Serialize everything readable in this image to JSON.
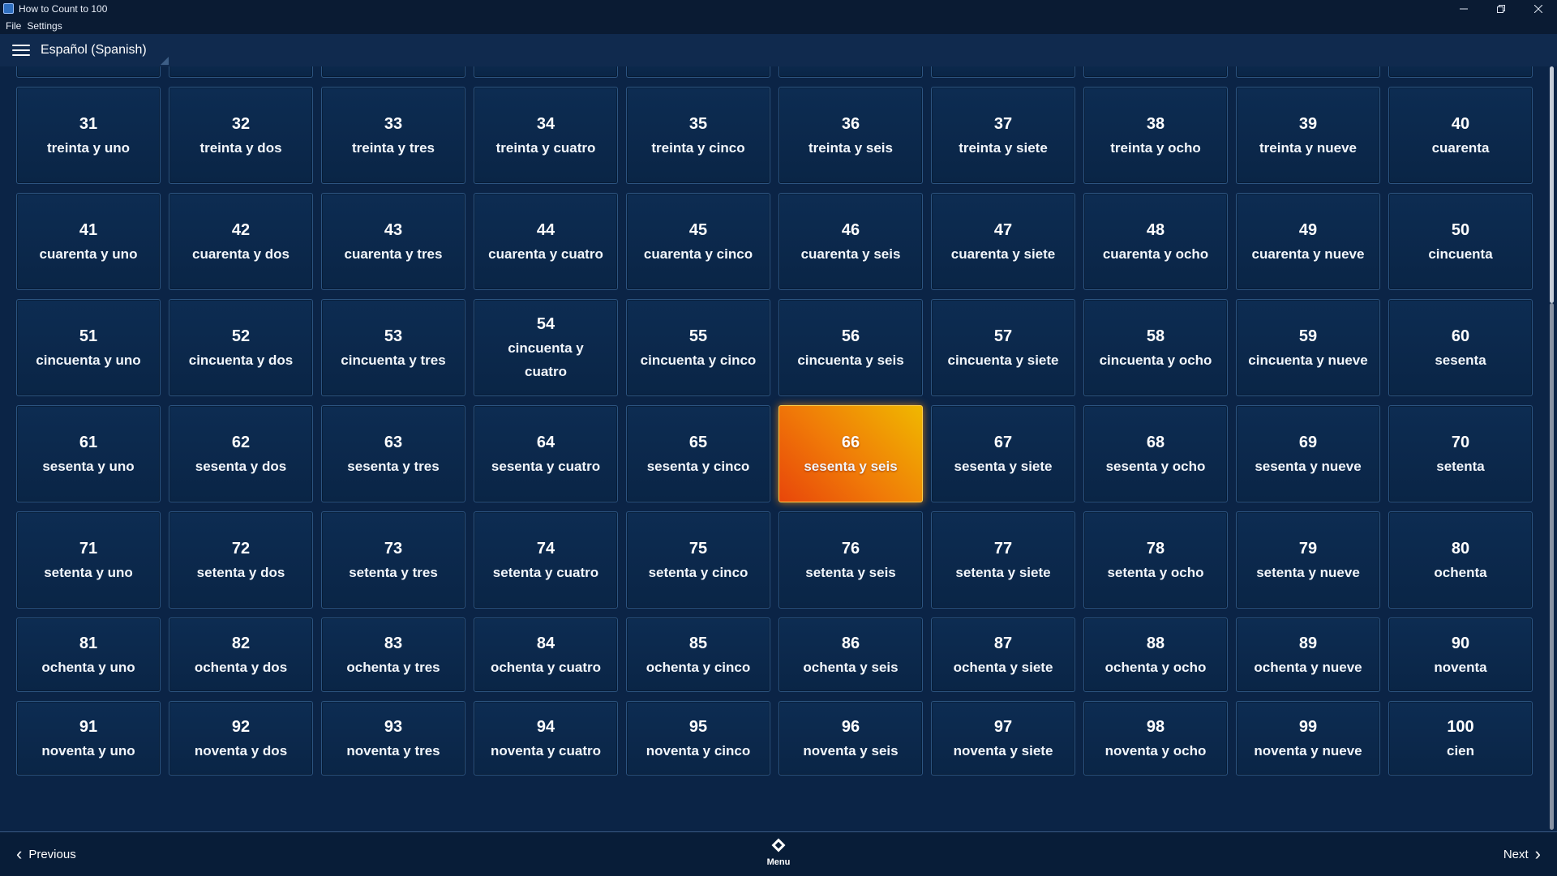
{
  "window": {
    "title": "How to Count to 100"
  },
  "menubar": {
    "items": [
      "File",
      "Settings"
    ]
  },
  "header": {
    "language": "Español (Spanish)"
  },
  "grid": {
    "active_number": 66,
    "tiles": [
      {
        "n": "31",
        "w": "treinta y uno"
      },
      {
        "n": "32",
        "w": "treinta y dos"
      },
      {
        "n": "33",
        "w": "treinta y tres"
      },
      {
        "n": "34",
        "w": "treinta y cuatro"
      },
      {
        "n": "35",
        "w": "treinta y cinco"
      },
      {
        "n": "36",
        "w": "treinta y seis"
      },
      {
        "n": "37",
        "w": "treinta y siete"
      },
      {
        "n": "38",
        "w": "treinta y ocho"
      },
      {
        "n": "39",
        "w": "treinta y nueve"
      },
      {
        "n": "40",
        "w": "cuarenta"
      },
      {
        "n": "41",
        "w": "cuarenta y uno"
      },
      {
        "n": "42",
        "w": "cuarenta y dos"
      },
      {
        "n": "43",
        "w": "cuarenta y tres"
      },
      {
        "n": "44",
        "w": "cuarenta y cuatro"
      },
      {
        "n": "45",
        "w": "cuarenta y cinco"
      },
      {
        "n": "46",
        "w": "cuarenta y seis"
      },
      {
        "n": "47",
        "w": "cuarenta y siete"
      },
      {
        "n": "48",
        "w": "cuarenta y ocho"
      },
      {
        "n": "49",
        "w": "cuarenta y nueve"
      },
      {
        "n": "50",
        "w": "cincuenta"
      },
      {
        "n": "51",
        "w": "cincuenta y uno"
      },
      {
        "n": "52",
        "w": "cincuenta y dos"
      },
      {
        "n": "53",
        "w": "cincuenta y tres"
      },
      {
        "n": "54",
        "w": "cincuenta y cuatro"
      },
      {
        "n": "55",
        "w": "cincuenta y cinco"
      },
      {
        "n": "56",
        "w": "cincuenta y seis"
      },
      {
        "n": "57",
        "w": "cincuenta y siete"
      },
      {
        "n": "58",
        "w": "cincuenta y ocho"
      },
      {
        "n": "59",
        "w": "cincuenta y nueve"
      },
      {
        "n": "60",
        "w": "sesenta"
      },
      {
        "n": "61",
        "w": "sesenta y uno"
      },
      {
        "n": "62",
        "w": "sesenta y dos"
      },
      {
        "n": "63",
        "w": "sesenta y tres"
      },
      {
        "n": "64",
        "w": "sesenta y cuatro"
      },
      {
        "n": "65",
        "w": "sesenta y cinco"
      },
      {
        "n": "66",
        "w": "sesenta y seis"
      },
      {
        "n": "67",
        "w": "sesenta y siete"
      },
      {
        "n": "68",
        "w": "sesenta y ocho"
      },
      {
        "n": "69",
        "w": "sesenta y nueve"
      },
      {
        "n": "70",
        "w": "setenta"
      },
      {
        "n": "71",
        "w": "setenta y uno"
      },
      {
        "n": "72",
        "w": "setenta y dos"
      },
      {
        "n": "73",
        "w": "setenta y tres"
      },
      {
        "n": "74",
        "w": "setenta y cuatro"
      },
      {
        "n": "75",
        "w": "setenta y cinco"
      },
      {
        "n": "76",
        "w": "setenta y seis"
      },
      {
        "n": "77",
        "w": "setenta y siete"
      },
      {
        "n": "78",
        "w": "setenta y ocho"
      },
      {
        "n": "79",
        "w": "setenta y nueve"
      },
      {
        "n": "80",
        "w": "ochenta"
      },
      {
        "n": "81",
        "w": "ochenta y uno"
      },
      {
        "n": "82",
        "w": "ochenta y dos"
      },
      {
        "n": "83",
        "w": "ochenta y tres"
      },
      {
        "n": "84",
        "w": "ochenta y cuatro"
      },
      {
        "n": "85",
        "w": "ochenta y cinco"
      },
      {
        "n": "86",
        "w": "ochenta y seis"
      },
      {
        "n": "87",
        "w": "ochenta y siete"
      },
      {
        "n": "88",
        "w": "ochenta y ocho"
      },
      {
        "n": "89",
        "w": "ochenta y nueve"
      },
      {
        "n": "90",
        "w": "noventa"
      },
      {
        "n": "91",
        "w": "noventa y uno"
      },
      {
        "n": "92",
        "w": "noventa y dos"
      },
      {
        "n": "93",
        "w": "noventa y tres"
      },
      {
        "n": "94",
        "w": "noventa y cuatro"
      },
      {
        "n": "95",
        "w": "noventa y cinco"
      },
      {
        "n": "96",
        "w": "noventa y seis"
      },
      {
        "n": "97",
        "w": "noventa y siete"
      },
      {
        "n": "98",
        "w": "noventa y ocho"
      },
      {
        "n": "99",
        "w": "noventa y nueve"
      },
      {
        "n": "100",
        "w": "cien"
      }
    ]
  },
  "footer": {
    "previous_label": "Previous",
    "menu_label": "Menu",
    "next_label": "Next"
  },
  "colors": {
    "background": "#0b2446",
    "tile": "#0d2c52",
    "tile_border": "#2c5480",
    "active_start": "#e8460a",
    "active_end": "#f0b800"
  },
  "icons": {
    "menu": "hamburger-icon",
    "footer_menu": "diamond-icon",
    "prev": "chevron-left-icon",
    "next": "chevron-right-icon"
  }
}
